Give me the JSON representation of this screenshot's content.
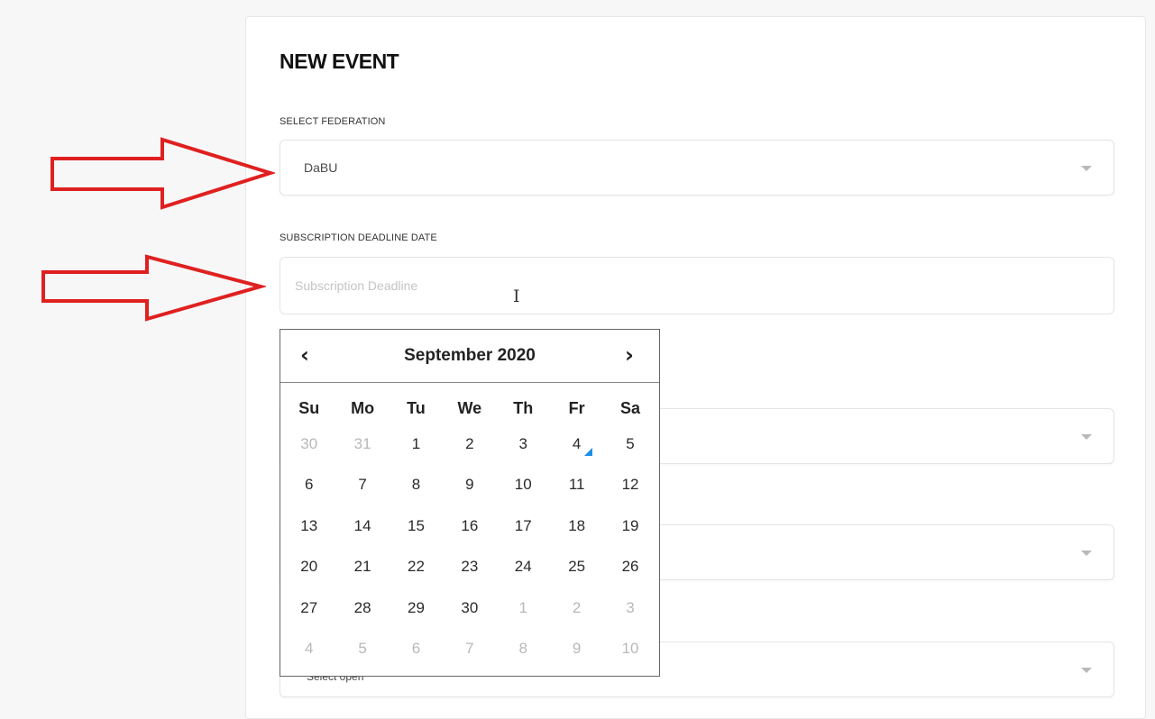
{
  "form": {
    "title": "NEW EVENT",
    "federation_label": "SELECT FEDERATION",
    "federation_value": "DaBU",
    "deadline_label": "SUBSCRIPTION DEADLINE DATE",
    "deadline_placeholder": "Subscription Deadline",
    "hidden_field_text": "Select open"
  },
  "datepicker": {
    "month_label": "September 2020",
    "prev_icon": "chevron-left-icon",
    "next_icon": "chevron-right-icon",
    "weekdays": [
      "Su",
      "Mo",
      "Tu",
      "We",
      "Th",
      "Fr",
      "Sa"
    ],
    "weeks": [
      [
        {
          "d": "30",
          "m": true
        },
        {
          "d": "31",
          "m": true
        },
        {
          "d": "1"
        },
        {
          "d": "2"
        },
        {
          "d": "3"
        },
        {
          "d": "4",
          "today": true
        },
        {
          "d": "5"
        }
      ],
      [
        {
          "d": "6"
        },
        {
          "d": "7"
        },
        {
          "d": "8"
        },
        {
          "d": "9"
        },
        {
          "d": "10"
        },
        {
          "d": "11"
        },
        {
          "d": "12"
        }
      ],
      [
        {
          "d": "13"
        },
        {
          "d": "14"
        },
        {
          "d": "15"
        },
        {
          "d": "16"
        },
        {
          "d": "17"
        },
        {
          "d": "18"
        },
        {
          "d": "19"
        }
      ],
      [
        {
          "d": "20"
        },
        {
          "d": "21"
        },
        {
          "d": "22"
        },
        {
          "d": "23"
        },
        {
          "d": "24"
        },
        {
          "d": "25"
        },
        {
          "d": "26"
        }
      ],
      [
        {
          "d": "27"
        },
        {
          "d": "28"
        },
        {
          "d": "29"
        },
        {
          "d": "30"
        },
        {
          "d": "1",
          "m": true
        },
        {
          "d": "2",
          "m": true
        },
        {
          "d": "3",
          "m": true
        }
      ],
      [
        {
          "d": "4",
          "m": true
        },
        {
          "d": "5",
          "m": true
        },
        {
          "d": "6",
          "m": true
        },
        {
          "d": "7",
          "m": true
        },
        {
          "d": "8",
          "m": true
        },
        {
          "d": "9",
          "m": true
        },
        {
          "d": "10",
          "m": true
        }
      ]
    ]
  },
  "colors": {
    "arrow": "#e02020",
    "today_marker": "#1a8fe6"
  }
}
